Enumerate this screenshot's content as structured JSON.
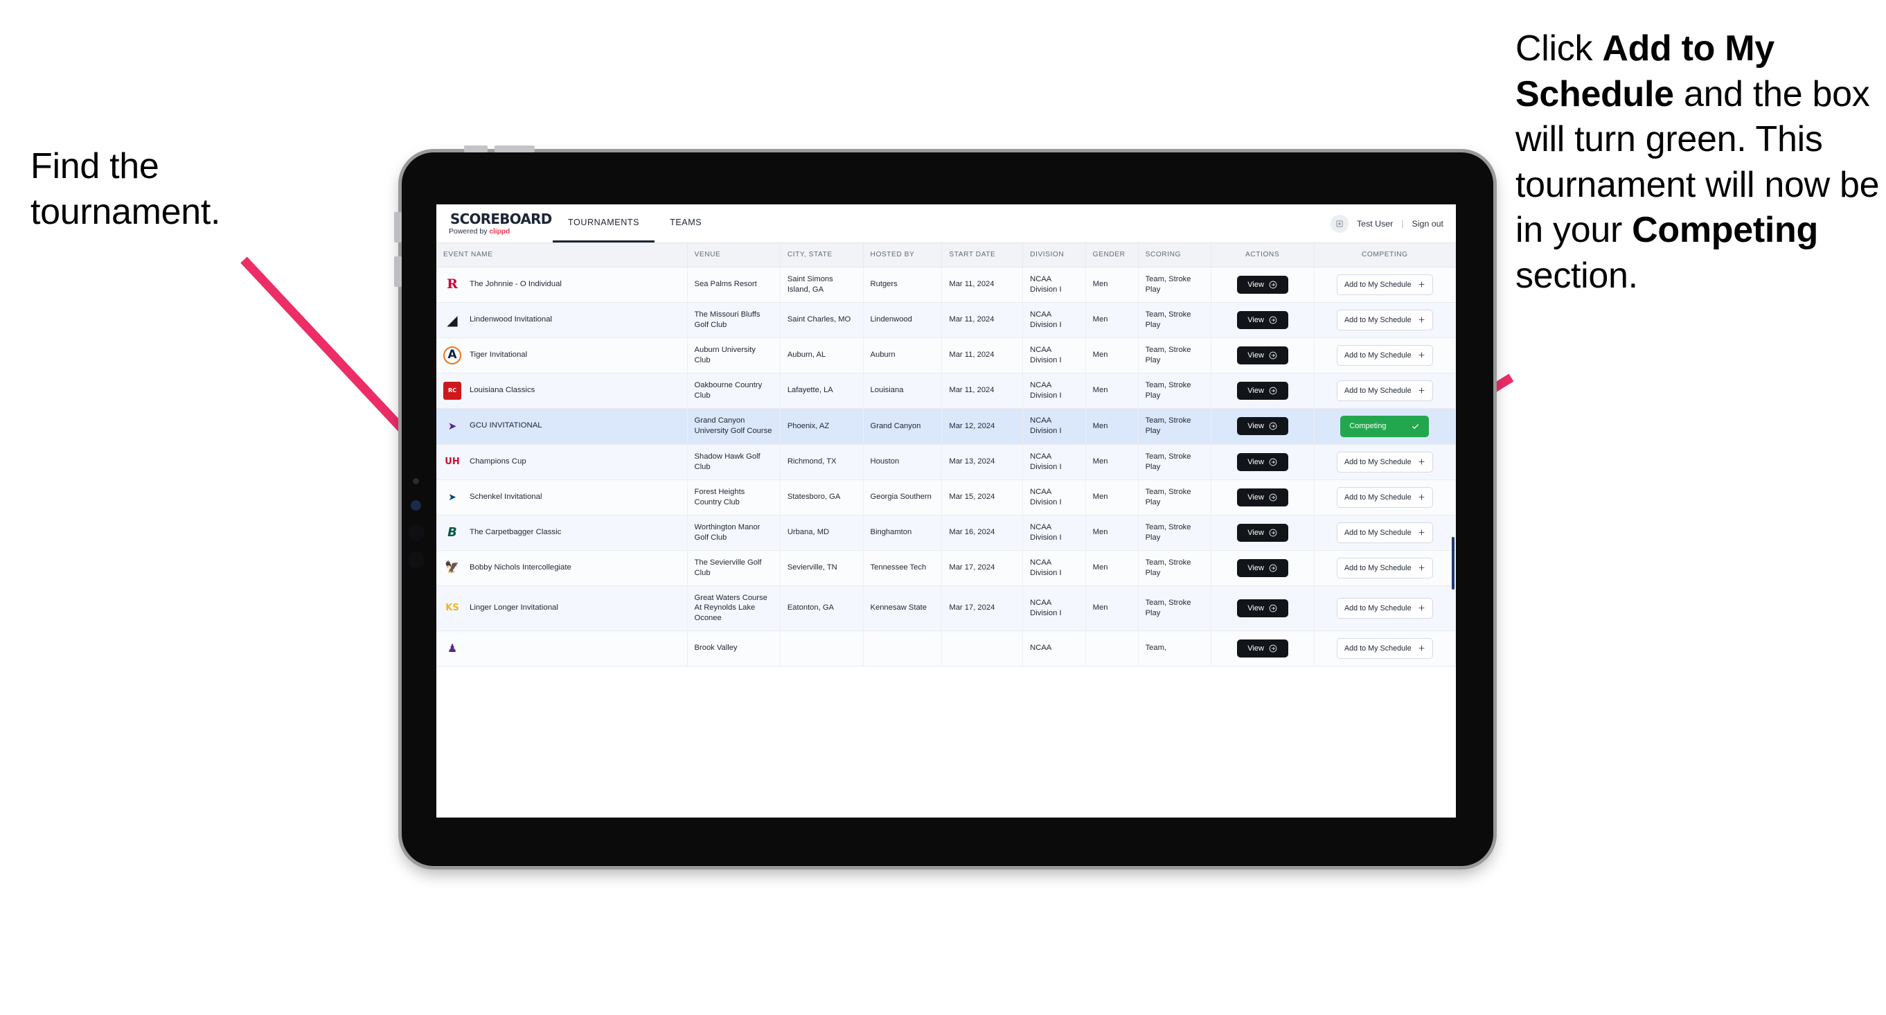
{
  "annotations": {
    "left": {
      "text": "Find the tournament."
    },
    "right": {
      "segments": [
        {
          "t": "Click ",
          "bold": false
        },
        {
          "t": "Add to My Schedule",
          "bold": true
        },
        {
          "t": " and the box will turn green. This tournament will now be in your ",
          "bold": false
        },
        {
          "t": "Competing",
          "bold": true
        },
        {
          "t": " section.",
          "bold": false
        }
      ]
    },
    "arrow_color": "#ec2d66"
  },
  "app": {
    "brand": {
      "title": "SCOREBOARD",
      "powered_prefix": "Powered by ",
      "powered_brand": "clippd"
    },
    "nav": [
      {
        "label": "TOURNAMENTS",
        "active": true
      },
      {
        "label": "TEAMS",
        "active": false
      }
    ],
    "user": {
      "name": "Test User",
      "separator": "|",
      "signout": "Sign out",
      "avatar_icon": "user-avatar-icon"
    }
  },
  "table": {
    "columns": [
      "EVENT NAME",
      "VENUE",
      "CITY, STATE",
      "HOSTED BY",
      "START DATE",
      "DIVISION",
      "GENDER",
      "SCORING",
      "ACTIONS",
      "COMPETING"
    ],
    "labels": {
      "view": "View",
      "add": "Add to My Schedule",
      "add_icon": "plus-icon",
      "competing": "Competing",
      "competing_icon": "check-icon",
      "view_icon": "arrow-circle-right-icon"
    },
    "rows": [
      {
        "logo": "rutgers-logo",
        "event": "The Johnnie - O Individual",
        "venue": "Sea Palms Resort",
        "city": "Saint Simons Island, GA",
        "host": "Rutgers",
        "date": "Mar 11, 2024",
        "division": "NCAA Division I",
        "gender": "Men",
        "scoring": "Team, Stroke Play",
        "competing": false
      },
      {
        "logo": "lindenwood-logo",
        "event": "Lindenwood Invitational",
        "venue": "The Missouri Bluffs Golf Club",
        "city": "Saint Charles, MO",
        "host": "Lindenwood",
        "date": "Mar 11, 2024",
        "division": "NCAA Division I",
        "gender": "Men",
        "scoring": "Team, Stroke Play",
        "competing": false
      },
      {
        "logo": "auburn-logo",
        "event": "Tiger Invitational",
        "venue": "Auburn University Club",
        "city": "Auburn, AL",
        "host": "Auburn",
        "date": "Mar 11, 2024",
        "division": "NCAA Division I",
        "gender": "Men",
        "scoring": "Team, Stroke Play",
        "competing": false
      },
      {
        "logo": "louisiana-ragin-cajuns-logo",
        "event": "Louisiana Classics",
        "venue": "Oakbourne Country Club",
        "city": "Lafayette, LA",
        "host": "Louisiana",
        "date": "Mar 11, 2024",
        "division": "NCAA Division I",
        "gender": "Men",
        "scoring": "Team, Stroke Play",
        "competing": false
      },
      {
        "logo": "grand-canyon-lopes-logo",
        "event": "GCU INVITATIONAL",
        "venue": "Grand Canyon University Golf Course",
        "city": "Phoenix, AZ",
        "host": "Grand Canyon",
        "date": "Mar 12, 2024",
        "division": "NCAA Division I",
        "gender": "Men",
        "scoring": "Team, Stroke Play",
        "competing": true,
        "selected": true
      },
      {
        "logo": "houston-cougars-logo",
        "event": "Champions Cup",
        "venue": "Shadow Hawk Golf Club",
        "city": "Richmond, TX",
        "host": "Houston",
        "date": "Mar 13, 2024",
        "division": "NCAA Division I",
        "gender": "Men",
        "scoring": "Team, Stroke Play",
        "competing": false
      },
      {
        "logo": "georgia-southern-eagles-logo",
        "event": "Schenkel Invitational",
        "venue": "Forest Heights Country Club",
        "city": "Statesboro, GA",
        "host": "Georgia Southern",
        "date": "Mar 15, 2024",
        "division": "NCAA Division I",
        "gender": "Men",
        "scoring": "Team, Stroke Play",
        "competing": false
      },
      {
        "logo": "binghamton-bearcats-logo",
        "event": "The Carpetbagger Classic",
        "venue": "Worthington Manor Golf Club",
        "city": "Urbana, MD",
        "host": "Binghamton",
        "date": "Mar 16, 2024",
        "division": "NCAA Division I",
        "gender": "Men",
        "scoring": "Team, Stroke Play",
        "competing": false
      },
      {
        "logo": "tennessee-tech-golden-eagles-logo",
        "event": "Bobby Nichols Intercollegiate",
        "venue": "The Sevierville Golf Club",
        "city": "Sevierville, TN",
        "host": "Tennessee Tech",
        "date": "Mar 17, 2024",
        "division": "NCAA Division I",
        "gender": "Men",
        "scoring": "Team, Stroke Play",
        "competing": false
      },
      {
        "logo": "kennesaw-state-owls-logo",
        "event": "Linger Longer Invitational",
        "venue": "Great Waters Course At Reynolds Lake Oconee",
        "city": "Eatonton, GA",
        "host": "Kennesaw State",
        "date": "Mar 17, 2024",
        "division": "NCAA Division I",
        "gender": "Men",
        "scoring": "Team, Stroke Play",
        "competing": false
      },
      {
        "logo": "east-carolina-pirates-logo",
        "event": "",
        "venue": "Brook Valley",
        "city": "",
        "host": "",
        "date": "",
        "division": "NCAA",
        "gender": "",
        "scoring": "Team,",
        "competing": false,
        "partial": true
      }
    ]
  },
  "colors": {
    "accent_green": "#22a74e",
    "arrow_pink": "#ec2d66",
    "selected_row": "#dbe7fb",
    "dark_button": "#111418",
    "clippd_red": "#ef3d57"
  }
}
